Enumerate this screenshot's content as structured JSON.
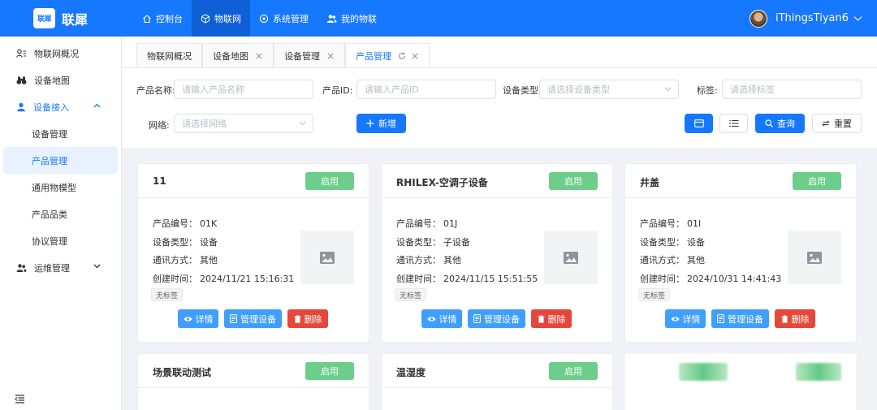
{
  "brand": {
    "logo_text": "联犀",
    "name": "联犀",
    "color": "#1677ff"
  },
  "topnav": [
    {
      "label": "控制台",
      "icon": "home-icon"
    },
    {
      "label": "物联网",
      "icon": "cube-icon",
      "active": true
    },
    {
      "label": "系统管理",
      "icon": "gear-icon"
    },
    {
      "label": "我的物联",
      "icon": "users-icon"
    }
  ],
  "user": {
    "name": "iThingsTiyan6"
  },
  "sidebar": {
    "items": [
      {
        "label": "物联网概况",
        "icon": "overview-icon"
      },
      {
        "label": "设备地图",
        "icon": "binoculars-icon"
      },
      {
        "label": "设备接入",
        "icon": "user-icon",
        "open": true
      },
      {
        "label": "运维管理",
        "icon": "team-icon"
      }
    ],
    "sub_items": [
      {
        "label": "设备管理"
      },
      {
        "label": "产品管理",
        "active": true
      },
      {
        "label": "通用物模型"
      },
      {
        "label": "产品品类"
      },
      {
        "label": "协议管理"
      }
    ]
  },
  "tabs": [
    {
      "label": "物联网概况"
    },
    {
      "label": "设备地图",
      "closable": true
    },
    {
      "label": "设备管理",
      "closable": true
    },
    {
      "label": "产品管理",
      "closable": true,
      "active": true
    }
  ],
  "filters": {
    "product_name": {
      "label": "产品名称:",
      "placeholder": "请输入产品名称"
    },
    "product_id": {
      "label": "产品ID:",
      "placeholder": "请输入产品ID"
    },
    "device_type": {
      "label": "设备类型:",
      "placeholder": "请选择设备类型"
    },
    "tags": {
      "label": "标签:",
      "placeholder": "请选择标签"
    },
    "network": {
      "label": "网络:",
      "placeholder": "请选择网络"
    },
    "add_label": "新增",
    "query_label": "查询",
    "reset_label": "重置"
  },
  "field_labels": {
    "product_no": "产品编号：",
    "device_type": "设备类型：",
    "comm_mode": "通讯方式：",
    "created_at": "创建时间："
  },
  "actions": {
    "detail": "详情",
    "manage": "管理设备",
    "delete": "删除"
  },
  "status_color": "#6cce8a",
  "cards": [
    {
      "title": "11",
      "status": "启用",
      "product_no": "01K",
      "device_type": "设备",
      "comm_mode": "其他",
      "created_at": "2024/11/21 15:16:31",
      "tag": "无标签"
    },
    {
      "title": "RHILEX-空调子设备",
      "status": "启用",
      "product_no": "01J",
      "device_type": "子设备",
      "comm_mode": "其他",
      "created_at": "2024/11/15 15:51:55",
      "tag": "无标签"
    },
    {
      "title": "井盖",
      "status": "启用",
      "product_no": "01I",
      "device_type": "设备",
      "comm_mode": "其他",
      "created_at": "2024/10/31 14:41:43",
      "tag": "无标签"
    },
    {
      "title": "场景联动测试",
      "status": "启用"
    },
    {
      "title": "温湿度",
      "status": "启用"
    }
  ]
}
